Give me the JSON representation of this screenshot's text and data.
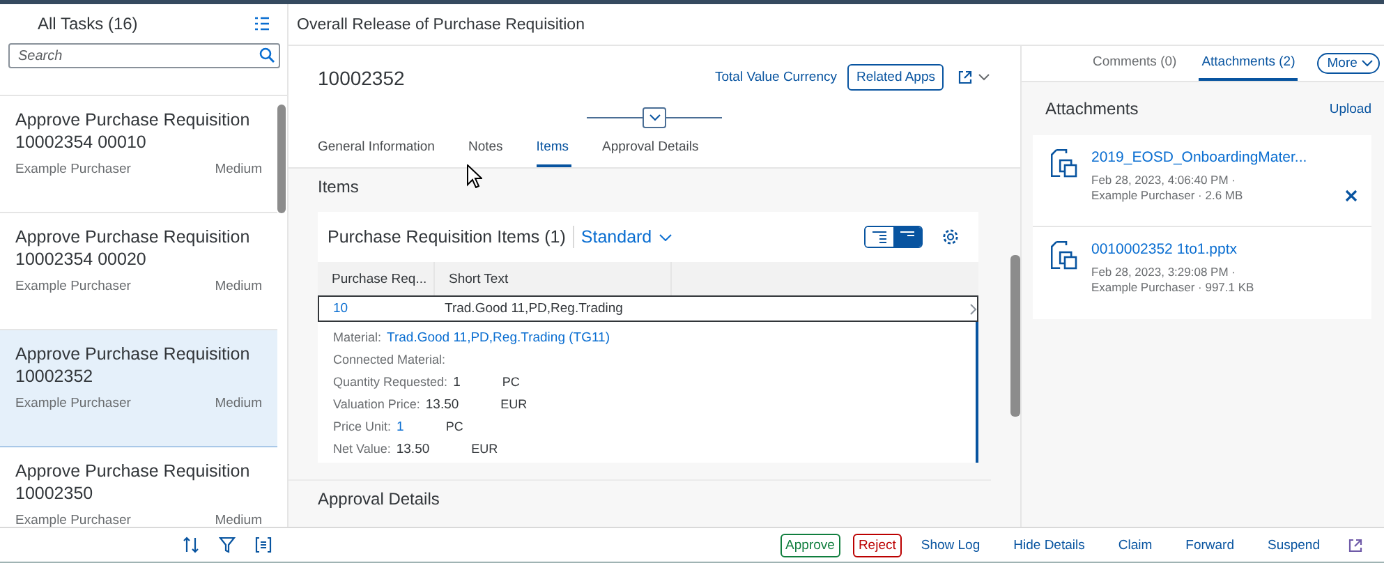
{
  "task_list": {
    "title": "All Tasks (16)",
    "search": {
      "placeholder": "Search"
    },
    "items": [
      {
        "title": "Approve Purchase Requisition",
        "number": "10002354 00010",
        "creator": "Example Purchaser",
        "priority": "Medium",
        "selected": false
      },
      {
        "title": "Approve Purchase Requisition",
        "number": "10002354 00020",
        "creator": "Example Purchaser",
        "priority": "Medium",
        "selected": false
      },
      {
        "title": "Approve Purchase Requisition",
        "number": "10002352",
        "creator": "Example Purchaser",
        "priority": "Medium",
        "selected": true
      },
      {
        "title": "Approve Purchase Requisition",
        "number": "10002350",
        "creator": "Example Purchaser",
        "priority": "Medium",
        "selected": false
      }
    ]
  },
  "header": {
    "title": "Overall Release of Purchase Requisition"
  },
  "object": {
    "id": "10002352",
    "link": "Total Value Currency",
    "related_apps": "Related Apps"
  },
  "tabs": [
    {
      "label": "General Information",
      "selected": false
    },
    {
      "label": "Notes",
      "selected": false
    },
    {
      "label": "Items",
      "selected": true
    },
    {
      "label": "Approval Details",
      "selected": false
    }
  ],
  "section_title": "Items",
  "table": {
    "title": "Purchase Requisition Items (1)",
    "variant": "Standard",
    "view_toggle": [
      {
        "selected": false
      },
      {
        "selected": true
      }
    ],
    "columns": [
      "Purchase Req...",
      "Short Text"
    ],
    "rows": [
      {
        "cells": [
          "10",
          "Trad.Good 11,PD,Reg.Trading"
        ]
      }
    ],
    "details": [
      {
        "label": "Material:",
        "value": "Trad.Good 11,PD,Reg.Trading (TG11)",
        "kind": "link"
      },
      {
        "label": "Connected Material:",
        "kind": "text"
      },
      {
        "label": "Quantity Requested:",
        "value": "1",
        "unit": "PC",
        "kind": "text"
      },
      {
        "label": "Valuation Price:",
        "value": "13.50",
        "unit": "EUR",
        "kind": "text"
      },
      {
        "label": "Price Unit:",
        "value": "1",
        "unit": "PC",
        "kind": "link"
      },
      {
        "label": "Net Value:",
        "value": "13.50",
        "unit": "EUR",
        "kind": "text"
      }
    ]
  },
  "next_section": "Approval Details",
  "side": {
    "tabs": [
      {
        "label": "Comments (0)",
        "selected": false
      },
      {
        "label": "Attachments (2)",
        "selected": true
      }
    ],
    "more": "More",
    "title": "Attachments",
    "upload": "Upload",
    "attachments": [
      {
        "name": "2019_EOSD_OnboardingMater...",
        "date": "Feb 28, 2023, 4:06:40 PM ·",
        "info": "Example Purchaser · 2.6 MB",
        "deletable": true
      },
      {
        "name": "0010002352 1to1.pptx",
        "date": "Feb 28, 2023, 3:29:08 PM ·",
        "info": "Example Purchaser · 997.1 KB",
        "deletable": false
      }
    ]
  },
  "footer": {
    "actions": [
      {
        "label": "Approve",
        "kind": "accept"
      },
      {
        "label": "Reject",
        "kind": "reject"
      },
      {
        "label": "Show Log",
        "kind": "plain"
      },
      {
        "label": "Hide Details",
        "kind": "plain"
      },
      {
        "label": "Claim",
        "kind": "plain"
      },
      {
        "label": "Forward",
        "kind": "plain"
      },
      {
        "label": "Suspend",
        "kind": "plain"
      }
    ]
  }
}
